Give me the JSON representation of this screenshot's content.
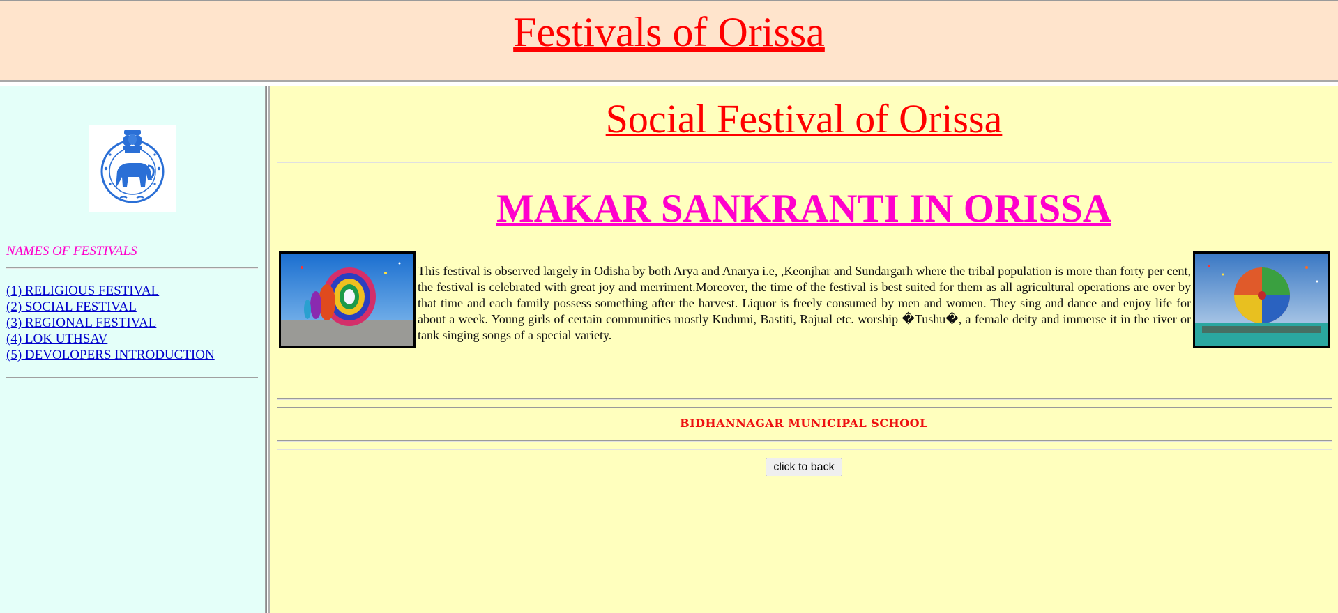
{
  "header": {
    "title": "Festivals of Orissa",
    "background": "#ffe4cc",
    "title_color": "#ff0000"
  },
  "sidebar": {
    "background": "#e4fff9",
    "emblem_icon": "odisha-state-emblem",
    "heading": "NAMES OF FESTIVALS",
    "items": [
      {
        "label": "(1) RELIGIOUS FESTIVAL"
      },
      {
        "label": "(2) SOCIAL FESTIVAL"
      },
      {
        "label": "(3) REGIONAL FESTIVAL"
      },
      {
        "label": "(4) LOK UTHSAV"
      },
      {
        "label": "(5) DEVOLOPERS INTRODUCTION"
      }
    ]
  },
  "main": {
    "background": "#ffffbe",
    "title": "Social Festival of Orissa",
    "festival_heading": "MAKAR SANKRANTI IN ORISSA",
    "festival_heading_color": "#ff00cc",
    "left_image": "kite-festival-coiled-kite-photo",
    "right_image": "kite-festival-round-kite-photo",
    "description": "This festival is observed largely in Odisha by both Arya and Anarya i.e, ,Keonjhar and Sundargarh where the tribal population is more than forty per cent, the festival is celebrated with great joy and merriment.Moreover, the time of the festival is best suited for them as all agricultural operations are over by that time and each family possess something after the harvest. Liquor is freely consumed by men and women. They sing and dance and enjoy life for about a week. Young girls of certain communities mostly Kudumi, Bastiti, Rajual etc. worship �Tushu�, a female deity and immerse it in the river or tank singing songs of a special variety.",
    "footer_school": "BIDHANNAGAR MUNICIPAL SCHOOL",
    "back_button": "click to back"
  }
}
